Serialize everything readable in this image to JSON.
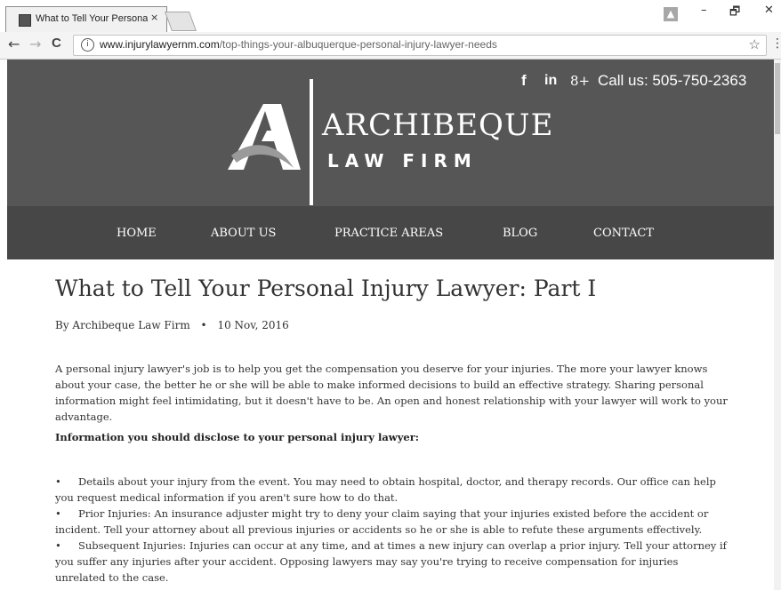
{
  "browser": {
    "tab_title": "What to Tell Your Persona",
    "tab_close": "×",
    "url_host": "www.injurylawyernm.com",
    "url_path": "/top-things-your-albuquerque-personal-injury-lawyer-needs",
    "back": "←",
    "forward": "→",
    "reload": "C",
    "info": "i",
    "star": "☆",
    "menu": "⋮",
    "minimize": "–",
    "restore": "🗗",
    "close": "✕",
    "profile": "▲"
  },
  "header": {
    "social": {
      "facebook": "f",
      "linkedin": "in",
      "google_plus": "8+"
    },
    "call": "Call us: 505-750-2363",
    "brand_name": "ARCHIBEQUE",
    "brand_sub": "LAW FIRM"
  },
  "nav": {
    "items": [
      {
        "label": "HOME"
      },
      {
        "label": "ABOUT US"
      },
      {
        "label": "PRACTICE AREAS"
      },
      {
        "label": "BLOG"
      },
      {
        "label": "CONTACT"
      }
    ]
  },
  "article": {
    "title": "What to Tell Your Personal Injury Lawyer: Part I",
    "author": "By Archibeque Law Firm",
    "separator": "•",
    "date": "10 Nov, 2016",
    "intro": "A personal injury lawyer's job is to help you get the compensation you deserve for your injuries. The more your lawyer knows about your case, the better he or she will be able to make informed decisions to build an effective strategy. Sharing personal information might feel intimidating, but it doesn't have to be. An open and honest relationship with your lawyer will work to your advantage.",
    "section_heading": "Information you should disclose to your personal injury lawyer:",
    "bullet_char": "•",
    "bullets": [
      "Details about your injury from the event. You may need to obtain hospital, doctor, and therapy records. Our office can help you request medical information if you aren't sure how to do that.",
      "Prior Injuries: An insurance adjuster might try to deny your claim saying that your injuries existed before the accident or incident. Tell your attorney about all previous injuries or accidents so he or she is able to refute these arguments effectively.",
      "Subsequent Injuries: Injuries can occur at any time, and at times a new injury can overlap a prior injury. Tell your attorney if you suffer any injuries after your accident. Opposing lawyers may say you're trying to receive compensation for injuries unrelated to the case."
    ]
  }
}
